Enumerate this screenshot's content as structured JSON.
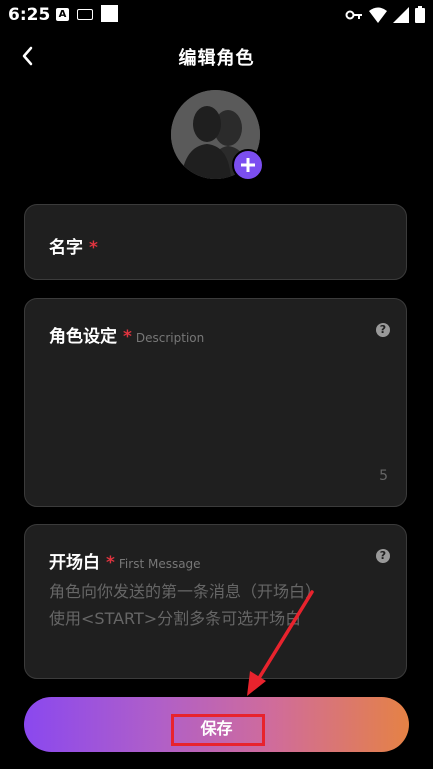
{
  "status_bar": {
    "time": "6:25",
    "a_icon_text": "A",
    "icons_right": [
      "key-icon",
      "wifi-icon",
      "signal-icon",
      "battery-icon"
    ]
  },
  "header": {
    "title": "编辑角色",
    "back_icon": "chevron-left-icon"
  },
  "avatar": {
    "add_icon": "plus-icon",
    "add_color": "#7b4ef0"
  },
  "fields": {
    "name": {
      "label": "名字",
      "required_mark": "*"
    },
    "description": {
      "label": "角色设定",
      "required_mark": "*",
      "hint": "Description",
      "help_icon": "?",
      "char_count": "5"
    },
    "first_message": {
      "label": "开场白",
      "required_mark": "*",
      "hint": "First Message",
      "help_icon": "?",
      "placeholder_line1": "角色向你发送的第一条消息（开场白）",
      "placeholder_line2": "使用<START>分割多条可选开场白"
    }
  },
  "save_button": {
    "label": "保存",
    "gradient": [
      "#8a48ef",
      "#e58245"
    ]
  },
  "colors": {
    "background": "#000000",
    "card": "#1f1f1f",
    "required": "#e0343f",
    "annotation": "#e8232d"
  }
}
